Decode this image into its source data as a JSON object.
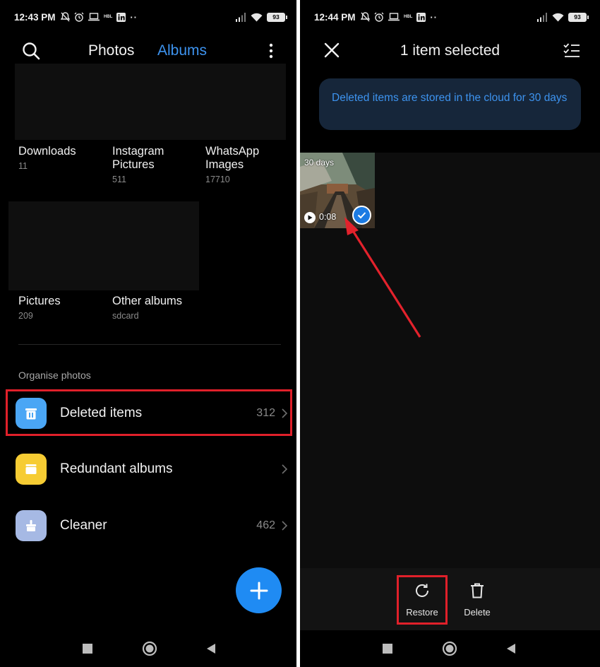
{
  "left": {
    "status": {
      "time": "12:43 PM",
      "battery": "93",
      "carrier_badge": "HBL"
    },
    "header": {
      "tab_photos": "Photos",
      "tab_albums": "Albums"
    },
    "albums": [
      {
        "name": "Downloads",
        "count": "11"
      },
      {
        "name": "Instagram\nPictures",
        "count": "511"
      },
      {
        "name": "WhatsApp\nImages",
        "count": "17710"
      },
      {
        "name": "Pictures",
        "count": "209"
      },
      {
        "name": "Other albums",
        "count": "sdcard"
      }
    ],
    "section_label": "Organise photos",
    "organise": [
      {
        "label": "Deleted items",
        "count": "312",
        "icon": "trash-icon",
        "color": "#4aa6f5"
      },
      {
        "label": "Redundant albums",
        "count": "",
        "icon": "folder-icon",
        "color": "#f6cc33"
      },
      {
        "label": "Cleaner",
        "count": "462",
        "icon": "broom-icon",
        "color": "#a6b9e4"
      }
    ]
  },
  "right": {
    "status": {
      "time": "12:44 PM",
      "battery": "93",
      "carrier_badge": "HBL"
    },
    "header": {
      "title": "1 item selected"
    },
    "info_message": "Deleted items are stored in the cloud for 30 days",
    "thumbnail": {
      "days_left": "30 days",
      "duration": "0:08"
    },
    "actions": {
      "restore": "Restore",
      "delete": "Delete"
    }
  },
  "colors": {
    "accent": "#1f8bf3",
    "tab_active": "#3d93ef",
    "highlight": "#e0202a",
    "arrow": "#e3222c"
  }
}
